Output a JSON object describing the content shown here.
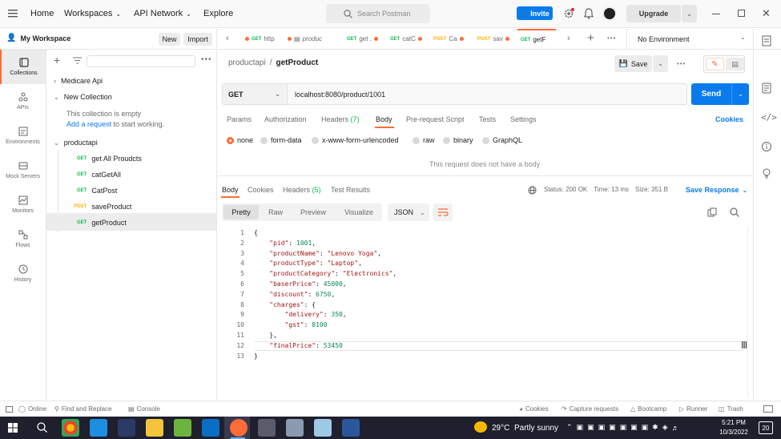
{
  "topbar": {
    "home": "Home",
    "workspaces": "Workspaces",
    "api_network": "API Network",
    "explore": "Explore",
    "search_placeholder": "Search Postman",
    "invite": "Invite",
    "upgrade": "Upgrade"
  },
  "workspace": {
    "name": "My Workspace",
    "new_label": "New",
    "import_label": "Import"
  },
  "leftnav": [
    {
      "label": "Collections",
      "icon": "collections-icon"
    },
    {
      "label": "APIs",
      "icon": "apis-icon"
    },
    {
      "label": "Environments",
      "icon": "environments-icon"
    },
    {
      "label": "Mock Servers",
      "icon": "mock-servers-icon"
    },
    {
      "label": "Monitors",
      "icon": "monitors-icon"
    },
    {
      "label": "Flows",
      "icon": "flows-icon"
    },
    {
      "label": "History",
      "icon": "history-icon"
    }
  ],
  "sidebar": {
    "medicare": "Medicare Api",
    "new_collection": "New Collection",
    "empty_text": "This collection is empty",
    "add_request_link": "Add a request",
    "add_request_rest": " to start working.",
    "productapi": "productapi",
    "requests": [
      {
        "method": "GET",
        "name": "get All Proudcts"
      },
      {
        "method": "GET",
        "name": "catGetAll"
      },
      {
        "method": "GET",
        "name": "CatPost"
      },
      {
        "method": "POST",
        "name": "saveProduct"
      },
      {
        "method": "GET",
        "name": "getProduct"
      }
    ]
  },
  "tabs": [
    {
      "method": "GET",
      "name": "http"
    },
    {
      "method": "",
      "name": "produc"
    },
    {
      "method": "GET",
      "name": "get ."
    },
    {
      "method": "GET",
      "name": "catC"
    },
    {
      "method": "POST",
      "name": "Ca"
    },
    {
      "method": "POST",
      "name": "sav"
    },
    {
      "method": "GET",
      "name": "getF"
    }
  ],
  "environment": "No Environment",
  "request": {
    "breadcrumb_parent": "productapi",
    "breadcrumb_sep": "/",
    "name": "getProduct",
    "save": "Save",
    "method": "GET",
    "url": "localhost:8080/product/1001",
    "send": "Send"
  },
  "req_tabs": {
    "params": "Params",
    "authorization": "Authorization",
    "headers": "Headers",
    "headers_count": "(7)",
    "body": "Body",
    "prerequest": "Pre-request Script",
    "tests": "Tests",
    "settings": "Settings",
    "cookies": "Cookies"
  },
  "body_types": [
    "none",
    "form-data",
    "x-www-form-urlencoded",
    "raw",
    "binary",
    "GraphQL"
  ],
  "no_body_text": "This request does not have a body",
  "response": {
    "tabs": {
      "body": "Body",
      "cookies": "Cookies",
      "headers": "Headers",
      "headers_count": "(5)",
      "test_results": "Test Results"
    },
    "status": "Status: 200 OK",
    "time": "Time: 13 ms",
    "size": "Size: 351 B",
    "save_response": "Save Response",
    "views": [
      "Pretty",
      "Raw",
      "Preview",
      "Visualize"
    ],
    "format": "JSON"
  },
  "code_lines": [
    "{",
    "    \"pid\": 1001,",
    "    \"productName\": \"Lenovo Yoga\",",
    "    \"productType\": \"Laptop\",",
    "    \"productCategory\": \"Electronics\",",
    "    \"baserPrice\": 45000,",
    "    \"discount\": 6750,",
    "    \"charges\": {",
    "        \"delivery\": 350,",
    "        \"gst\": 8100",
    "    },",
    "    \"finalPrice\": 53450",
    "}"
  ],
  "line_numbers": [
    "1",
    "2",
    "3",
    "4",
    "5",
    "6",
    "7",
    "8",
    "9",
    "10",
    "11",
    "12",
    "13"
  ],
  "statusbar": {
    "online": "Online",
    "find_replace": "Find and Replace",
    "console": "Console",
    "cookies": "Cookies",
    "capture": "Capture requests",
    "bootcamp": "Bootcamp",
    "runner": "Runner",
    "trash": "Trash"
  },
  "taskbar": {
    "weather_temp": "29°C",
    "weather_text": "Partly sunny",
    "time": "5:21 PM",
    "date": "10/3/2022",
    "notifications": "20"
  },
  "colors": {
    "accent": "#ff6c37",
    "send_blue": "#097bed",
    "get_green": "#0cbb52",
    "post_yellow": "#ffb400"
  }
}
